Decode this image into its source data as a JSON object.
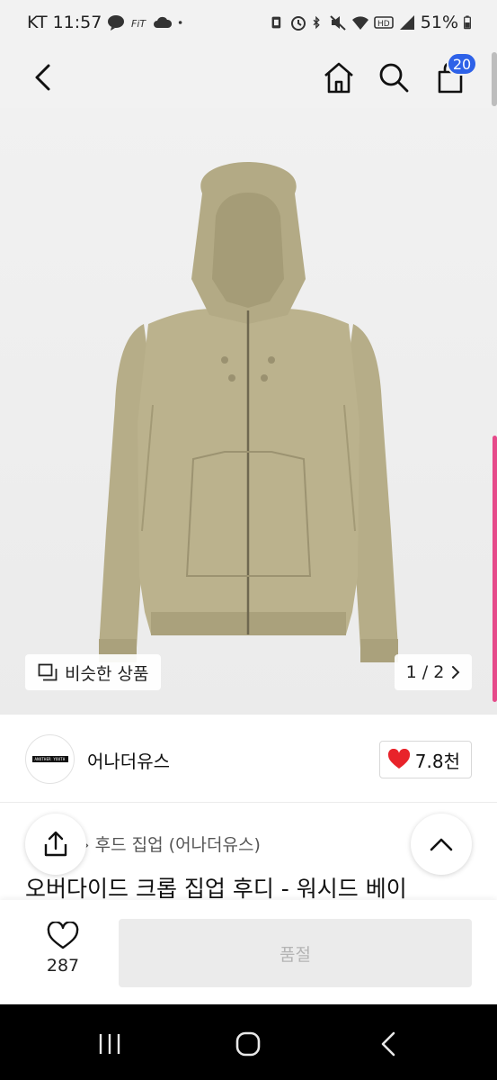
{
  "status": {
    "carrier": "KT",
    "time": "11:57",
    "left_icons": [
      "talk-icon",
      "fit-icon",
      "cloud-icon",
      "dot-icon"
    ],
    "right_icons": [
      "nfc-icon",
      "alarm-icon",
      "bluetooth-icon",
      "mute-icon",
      "wifi-icon",
      "hd-icon",
      "signal-icon"
    ],
    "battery": "51%"
  },
  "header": {
    "cart_count": "20",
    "icons": [
      "back-icon",
      "home-icon",
      "search-icon",
      "cart-icon"
    ]
  },
  "gallery": {
    "similar_label": "비슷한 상품",
    "page_label": "1 / 2",
    "product_color": "#b9b08a"
  },
  "brand": {
    "name": "어나더유스",
    "logo_text": "ANOTHER YOUTH",
    "likes": "7.8천"
  },
  "product": {
    "breadcrumb": "후드 집업 (어나더유스)",
    "title": "오버다이드 크롭 집업 후디 - 워시드 베이"
  },
  "bottom": {
    "wish_count": "287",
    "buy_label": "품절"
  },
  "colors": {
    "badge": "#2e62e8",
    "heart": "#e8232a",
    "accent_scroll": "#e64a8a"
  }
}
